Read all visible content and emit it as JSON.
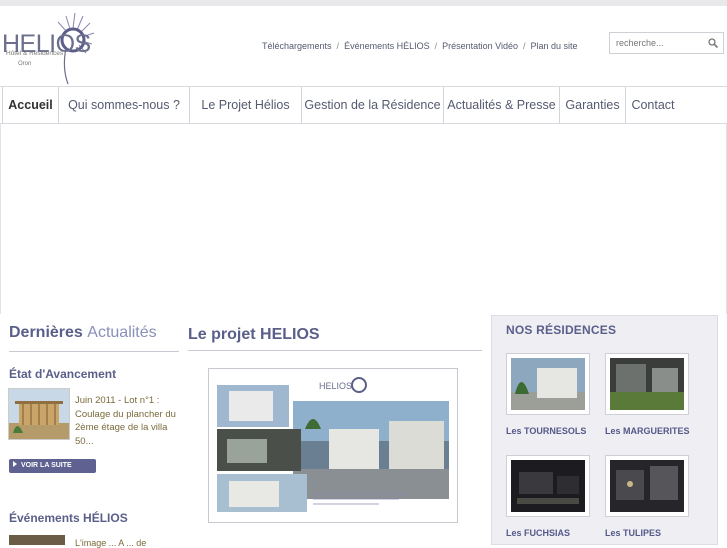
{
  "brand": {
    "name": "HELIOS",
    "tagline": "Hôtel & Résidences",
    "city": "Oron"
  },
  "top_links": [
    "Téléchargements",
    "Événements HÉLIOS",
    "Présentation Vidéo",
    "Plan du site"
  ],
  "top_links_separator": "/",
  "search": {
    "placeholder": "recherche..."
  },
  "nav": [
    "Accueil",
    "Qui sommes-nous ?",
    "Le Projet Hélios",
    "Gestion de la Résidence",
    "Actualités & Presse",
    "Garanties",
    "Contact"
  ],
  "news": {
    "title_bold": "Dernières",
    "title_light": "Actualités",
    "section1_title": "État d'Avancement",
    "item_text": "Juin 2011 - Lot n°1 : Coulage du plancher de la villa 50...",
    "item_text_display": "Juin 2011 - Lot n°1 : Coulage du plancher du 2ème étage de la villa 50...",
    "more_label": "VOIR LA SUITE",
    "section2_title": "Événements HÉLIOS",
    "section2_snippet": "L'image ... A ... de"
  },
  "project": {
    "title": "Le projet HELIOS"
  },
  "residences": {
    "title": "NOS RÉSIDENCES",
    "items": [
      "Les TOURNESOLS",
      "Les MARGUERITES",
      "Les FUCHSIAS",
      "Les TULIPES"
    ]
  },
  "colors": {
    "accent": "#5a5f8a",
    "button": "#5f6290",
    "news_text": "#7a6a3a",
    "panel_bg": "#eeeef3"
  }
}
